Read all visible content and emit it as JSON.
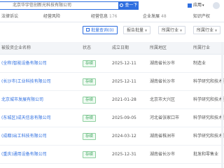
{
  "search": {
    "query": "北京华宇信创新光科技有限公司",
    "button_label": "查一下"
  },
  "top_right": {
    "app_label": "应用",
    "chevron": "▾"
  },
  "tabs": [
    {
      "label": "法律诉讼",
      "count": ""
    },
    {
      "label": "经营风险",
      "count": ""
    },
    {
      "label": "经营信息",
      "count": "176"
    },
    {
      "label": "企业发展",
      "count": "48"
    },
    {
      "label": "知识产权",
      "count": ""
    }
  ],
  "filters": [
    {
      "label": "批量查询",
      "extra": "(0)"
    },
    {
      "label": "报告批量"
    },
    {
      "label": "所属行业"
    },
    {
      "label": "所属行业"
    }
  ],
  "table": {
    "headers": [
      "被投资企业名称",
      "状态",
      "成立日期",
      "所属地区",
      "所属行业"
    ],
    "rows": [
      {
        "name": "(全称)智能设备有限公司",
        "status": "存续",
        "date": "2025-12-11",
        "region": "湖南省长沙市",
        "industry": "制造业"
      },
      {
        "name": "(长沙市)工业科技有限公司",
        "status": "存续",
        "date": "2025-12-11",
        "region": "湖南省长沙市",
        "industry": "科学研究和技术服务"
      },
      {
        "name": "北京城市发展有限公司",
        "status": "存续",
        "date": "2021-01-28",
        "region": "北京市大兴区",
        "industry": "科学研究和技术服务"
      },
      {
        "name": "(东城区)成天信息有限公司",
        "status": "存续",
        "date": "2025-09-05",
        "region": "河北省张家口市",
        "industry": "科学研究和技术服务"
      },
      {
        "name": "(成都)出工科技有限公司",
        "status": "存续",
        "date": "2024-03-12",
        "region": "湖南省株洲市",
        "industry": "科学研究和技术服务"
      },
      {
        "name": "(重庆)通用设备有限公司",
        "status": "存续",
        "date": "2025-12-31",
        "region": "湖南省长沙市",
        "industry": "批发和零售业"
      }
    ]
  }
}
